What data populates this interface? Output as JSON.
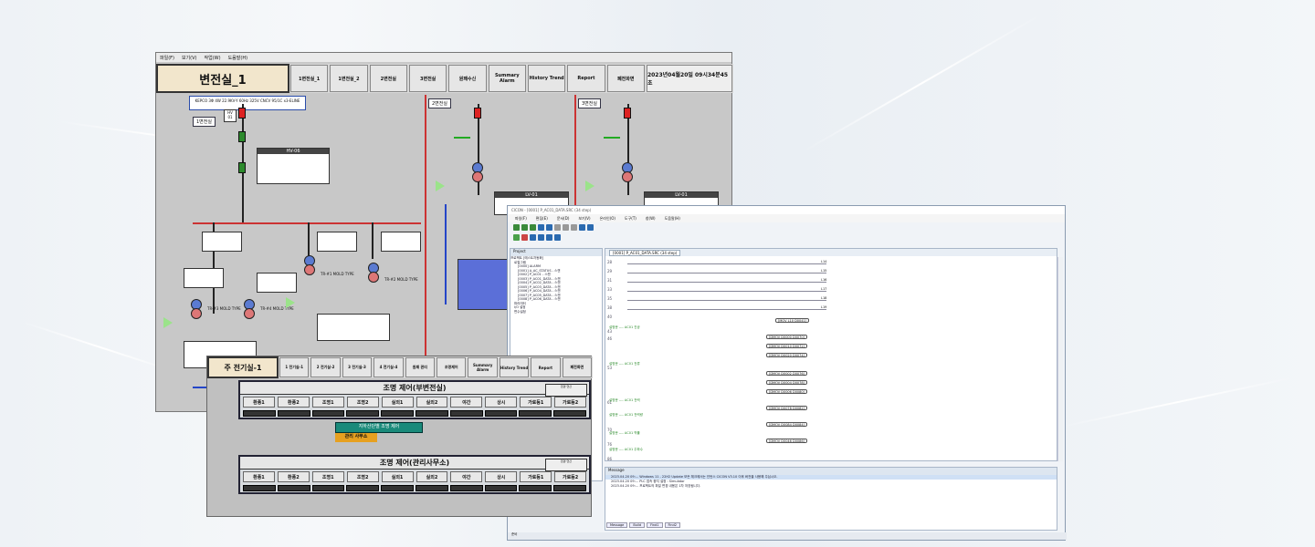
{
  "scada1": {
    "menu": [
      "파일(F)",
      "보기(V)",
      "작업(W)",
      "도움말(H)"
    ],
    "title": "변전실_1",
    "nav": [
      "1변전실_1",
      "1변전실_2",
      "2변전실",
      "3변전실",
      "원패수신",
      "Summary Alarm",
      "History Trend",
      "Report",
      "폐전화면"
    ],
    "datetime": "2023년04월20일 09시34분45초",
    "kepco": "KEPCO\n3Φ 4W 22.9KV-Y 60Hz 325V CNCV 95/1C x3-ELINE",
    "sections": [
      "1변전실",
      "2변전실",
      "3변전실"
    ],
    "hv": "HV-06",
    "lv": "LV-01",
    "tr_labels": [
      "TR-#1 MOLD TYPE",
      "TR-#2 MOLD TYPE",
      "TR-#3 MOLD TYPE",
      "TR-#4 MOLD TYPE"
    ],
    "tr_kva": [
      "3V:380-220V",
      "3V:380-220V"
    ],
    "alarm": "알람"
  },
  "scada2": {
    "title": "주 전기실-1",
    "nav": [
      "1 전기실-1",
      "2 전기실-2",
      "3 전기실-3",
      "4 전기실-4",
      "원패 관리",
      "조명제어",
      "Summary Alarm",
      "History Trend",
      "Report",
      "폐전화면"
    ],
    "panels": [
      {
        "title": "조명 제어(부변전실)",
        "buttons": [
          "환풍1",
          "환풍2",
          "조명1",
          "조명2",
          "실외1",
          "실외2",
          "야간",
          "상시",
          "가로등1",
          "가로등2"
        ]
      },
      {
        "title": "조명 제어(관리사무소)",
        "buttons": [
          "환풍1",
          "환풍2",
          "조명1",
          "조명2",
          "실외1",
          "실외2",
          "야간",
          "상시",
          "가로등1",
          "가로등2"
        ]
      }
    ],
    "sysbox": "환경 연산",
    "side_title": "지하산단별 조명 제어",
    "side_btn": "관리 사무소"
  },
  "ide": {
    "title": "CICON - [0001] P_AC01_DATA.SRC (34 step)",
    "menu": [
      "파일(F)",
      "편집(E)",
      "문서(D)",
      "보기(V)",
      "온라인(O)",
      "도구(T)",
      "창(W)",
      "도움말(H)"
    ],
    "project_header": "Project",
    "tree": [
      "프로젝트 [에스트자동화]",
      "로컬그램",
      "[0000] ALARM",
      "[0001] A_AC_STATUS - 스캔",
      "[0002] P_AC01 - 스캔",
      "[0003] P_AC01_DATA - 스캔",
      "[0004] P_AC02_DATA - 스캔",
      "[0005] P_AC03_DATA - 스캔",
      "[0006] P_AC04_DATA - 스캔",
      "[0007] P_AC05_DATA - 스캔",
      "[0008] P_AC06_DATA - 스캔",
      "파라미터",
      "I/O 설정",
      "변수설정"
    ],
    "editor_tab": "[0001] P_AC01_DATA.SRC (34 step)",
    "line_numbers": [
      "28",
      "29",
      "31",
      "33",
      "35",
      "38",
      "40",
      "43",
      "46",
      "49",
      "53",
      "56",
      "61",
      "66",
      "70",
      "76",
      "80",
      "86"
    ],
    "comments": [
      "설명문 ---- AC01 진공",
      "설명문 ---- AC01 전류",
      "설명문 ---- AC01 전력",
      "설명문 ---- AC01 전력량",
      "설명문 ---- AC01 역률",
      "설명문 ---- AC01 주파수"
    ],
    "coils": [
      "[MOV L10 D0041]",
      "[DMOV D0000 D0070]",
      "[DMOV D0010 D0072]",
      "[DMOV D0020 D0074]",
      "[DMOV D0002 D0076]",
      "[DMOV D0004 D0078]",
      "[DMOV D0006 D0080]",
      "[DMOV D0078 D0082]",
      "[DMOV D0084 D0084]",
      "[DMOV D0046 D0086]"
    ],
    "l_labels": [
      "L14",
      "L15",
      "L16",
      "L17",
      "L18",
      "L19"
    ],
    "msg_header": "Message",
    "messages": [
      "2023.04.20 09:... Windows 11 - 22H2 Update 모든 체크에서는 인턴스 CICON V3.10 이후 버전을 사용해 주십시오.",
      "2023.04.20 09:... PLC 접속 중지 설정 : Simulator",
      "2023.04.20 09:... 프로젝트의 파일 변경 내용은 1차 저장됩니다."
    ],
    "msg_tabs": [
      "Message",
      "Build",
      "Find1",
      "Find2"
    ],
    "status": "준비"
  }
}
